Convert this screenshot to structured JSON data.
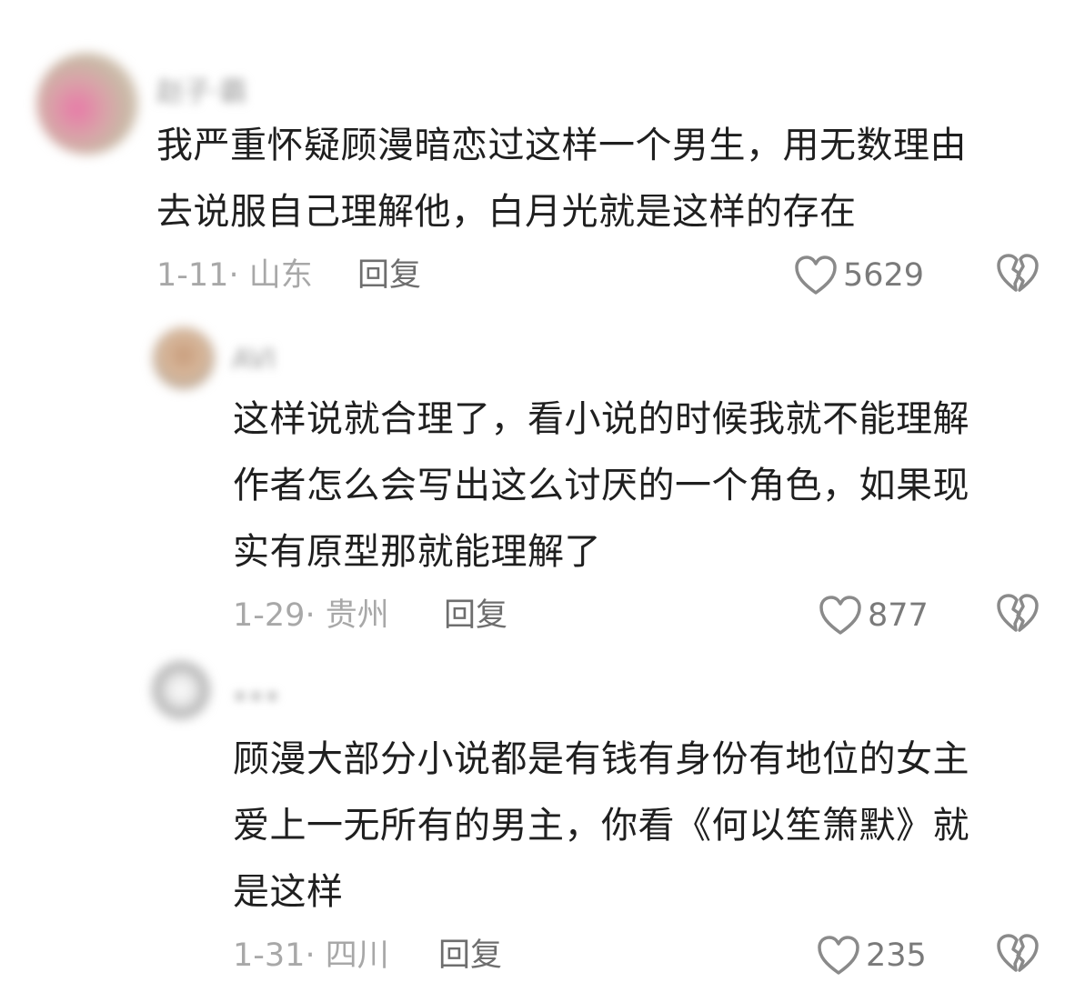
{
  "comments": [
    {
      "username": "赵子·霸",
      "lines": [
        "我严重怀疑顾漫暗恋过这样一个男生，用无数理由",
        "去说服自己理解他，白月光就是这样的存在"
      ],
      "date": "1-11",
      "location": "山东",
      "reply_label": "回复",
      "likes": "5629"
    },
    {
      "username": "AVI",
      "lines": [
        "这样说就合理了，看小说的时候我就不能理解",
        "作者怎么会写出这么讨厌的一个角色，如果现",
        "实有原型那就能理解了"
      ],
      "date": "1-29",
      "location": "贵州",
      "reply_label": "回复",
      "likes": "877"
    },
    {
      "username": "•••",
      "lines": [
        "顾漫大部分小说都是有钱有身份有地位的女主",
        "爱上一无所有的男主，你看《何以笙箫默》就",
        "是这样"
      ],
      "date": "1-31",
      "location": "四川",
      "reply_label": "回复",
      "likes": "235"
    }
  ],
  "icons": {
    "like": "heart-outline-icon",
    "dislike": "broken-heart-icon"
  },
  "colors": {
    "text": "#1f1f1f",
    "meta": "#a8a8a8",
    "reply": "#6e6e6e",
    "icon": "#8a8a8a"
  }
}
